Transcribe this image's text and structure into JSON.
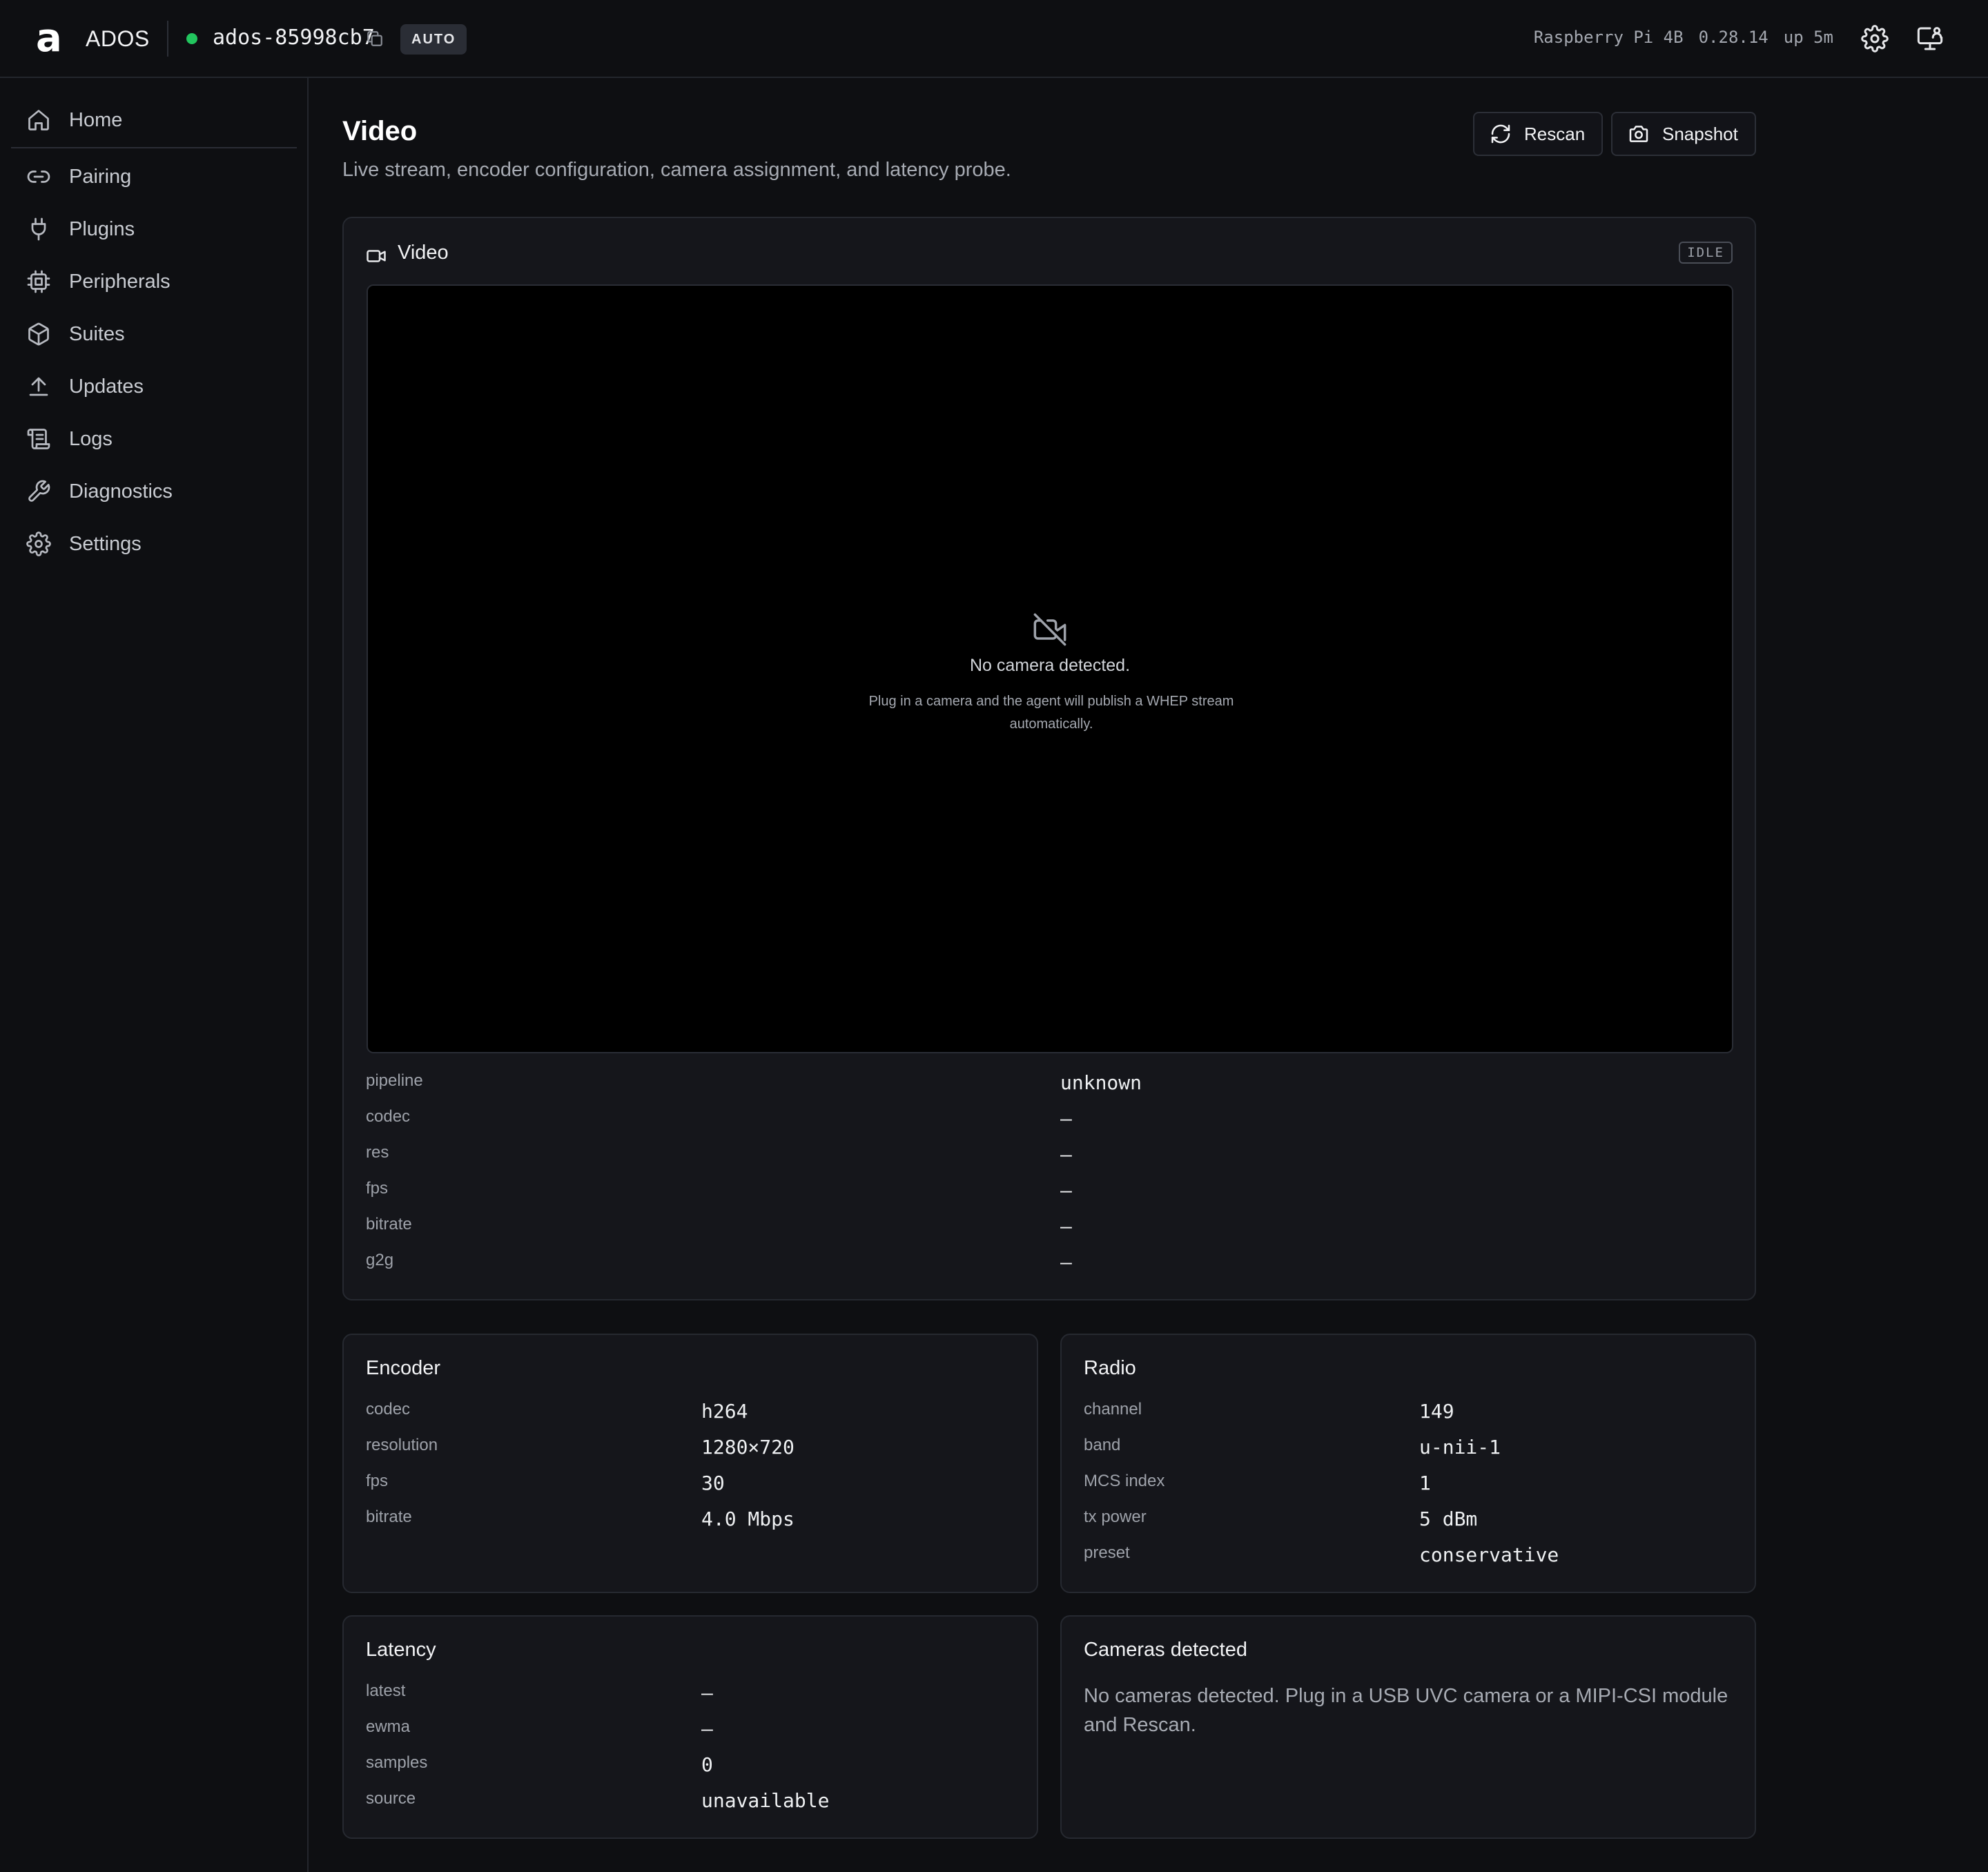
{
  "app": {
    "logo_glyph": "a",
    "name": "ADOS",
    "device_id": "ados-85998cb7",
    "status_color": "#22c55e",
    "mode": "AUTO",
    "board": "Raspberry Pi 4B",
    "version": "0.28.14",
    "uptime": "up 5m"
  },
  "sidebar": {
    "items": [
      {
        "label": "Home",
        "icon": "home-icon"
      },
      {
        "label": "Pairing",
        "icon": "link-icon"
      },
      {
        "label": "Plugins",
        "icon": "plug-icon"
      },
      {
        "label": "Peripherals",
        "icon": "chip-icon"
      },
      {
        "label": "Suites",
        "icon": "package-icon"
      },
      {
        "label": "Updates",
        "icon": "upload-icon"
      },
      {
        "label": "Logs",
        "icon": "scroll-icon"
      },
      {
        "label": "Diagnostics",
        "icon": "wrench-icon"
      },
      {
        "label": "Settings",
        "icon": "gear-icon"
      }
    ]
  },
  "page": {
    "title": "Video",
    "subtitle": "Live stream, encoder configuration, camera assignment, and latency probe.",
    "rescan_label": "Rescan",
    "snapshot_label": "Snapshot"
  },
  "video_card": {
    "title": "Video",
    "state": "IDLE",
    "empty_title": "No camera detected.",
    "empty_desc": "Plug in a camera and the agent will publish a WHEP stream automatically.",
    "stats": [
      {
        "label": "pipeline",
        "value": "unknown"
      },
      {
        "label": "codec",
        "value": "—"
      },
      {
        "label": "res",
        "value": "—"
      },
      {
        "label": "fps",
        "value": "—"
      },
      {
        "label": "bitrate",
        "value": "—"
      },
      {
        "label": "g2g",
        "value": "—"
      }
    ]
  },
  "encoder": {
    "title": "Encoder",
    "rows": [
      {
        "label": "codec",
        "value": "h264"
      },
      {
        "label": "resolution",
        "value": "1280×720"
      },
      {
        "label": "fps",
        "value": "30"
      },
      {
        "label": "bitrate",
        "value": "4.0 Mbps"
      }
    ]
  },
  "radio": {
    "title": "Radio",
    "rows": [
      {
        "label": "channel",
        "value": "149"
      },
      {
        "label": "band",
        "value": "u-nii-1"
      },
      {
        "label": "MCS index",
        "value": "1"
      },
      {
        "label": "tx power",
        "value": "5 dBm"
      },
      {
        "label": "preset",
        "value": "conservative"
      }
    ]
  },
  "latency": {
    "title": "Latency",
    "rows": [
      {
        "label": "latest",
        "value": "—"
      },
      {
        "label": "ewma",
        "value": "—"
      },
      {
        "label": "samples",
        "value": "0"
      },
      {
        "label": "source",
        "value": "unavailable"
      }
    ]
  },
  "cameras": {
    "title": "Cameras detected",
    "empty_text": "No cameras detected. Plug in a USB UVC camera or a MIPI-CSI module and Rescan."
  }
}
